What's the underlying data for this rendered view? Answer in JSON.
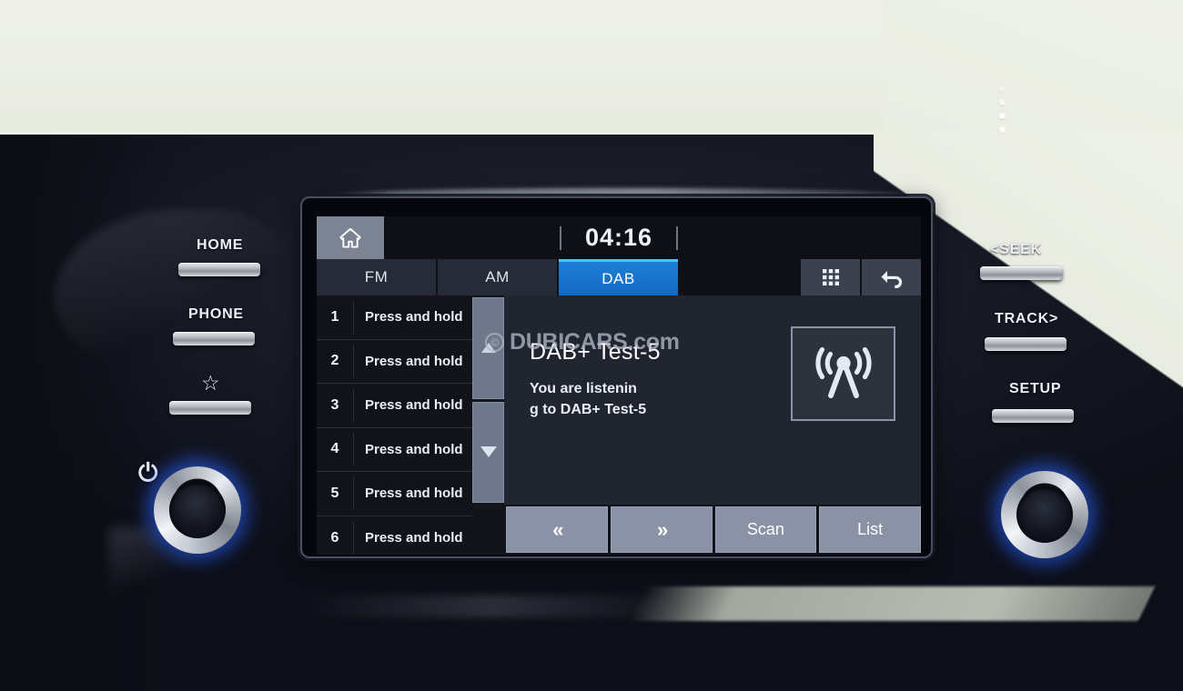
{
  "head_unit": {
    "screen": {
      "clock": "04:16",
      "home_icon": "home-icon",
      "tabs": [
        {
          "label": "FM",
          "active": false
        },
        {
          "label": "AM",
          "active": false
        },
        {
          "label": "DAB",
          "active": true
        }
      ],
      "toolbar_icons": [
        {
          "name": "grid-keypad-icon",
          "glyph": "grid"
        },
        {
          "name": "back-arrow-icon",
          "glyph": "undo"
        }
      ],
      "presets": [
        {
          "number": "1",
          "label": "Press and hold"
        },
        {
          "number": "2",
          "label": "Press and hold"
        },
        {
          "number": "3",
          "label": "Press and hold"
        },
        {
          "number": "4",
          "label": "Press and hold"
        },
        {
          "number": "5",
          "label": "Press and hold"
        },
        {
          "number": "6",
          "label": "Press and hold"
        }
      ],
      "scroll": {
        "up_label": "▲",
        "down_label": "▼"
      },
      "now_playing": {
        "station": "DAB+ Test-5",
        "radio_text_line1": "You are listenin",
        "radio_text_line2": "g to DAB+ Test-5",
        "logo_icon": "broadcast-tower-icon"
      },
      "bottom_buttons": [
        {
          "label": "«",
          "name": "prev-button"
        },
        {
          "label": "»",
          "name": "next-button"
        },
        {
          "label": "Scan",
          "name": "scan-button"
        },
        {
          "label": "List",
          "name": "list-button"
        }
      ],
      "watermark": {
        "copyright": "©",
        "text": "DUBICARS.com"
      }
    },
    "left_controls": [
      {
        "label": "HOME",
        "name": "home-hard-button"
      },
      {
        "label": "PHONE",
        "name": "phone-hard-button"
      },
      {
        "label": "☆",
        "name": "favorite-hard-button",
        "is_icon": true
      }
    ],
    "right_controls": [
      {
        "label": "<SEEK",
        "name": "seek-back-hard-button"
      },
      {
        "label": "TRACK>",
        "name": "track-forward-hard-button"
      },
      {
        "label": "SETUP",
        "name": "setup-hard-button"
      }
    ],
    "knobs": [
      {
        "name": "power-volume-knob",
        "icon": "⏻"
      },
      {
        "name": "tune-knob",
        "icon": ""
      }
    ],
    "colors": {
      "accent_tab": "#1269c4",
      "accent_tab_top": "#45c8ff",
      "knob_ring": "#285ae6",
      "button_face": "#8b92a6"
    }
  }
}
